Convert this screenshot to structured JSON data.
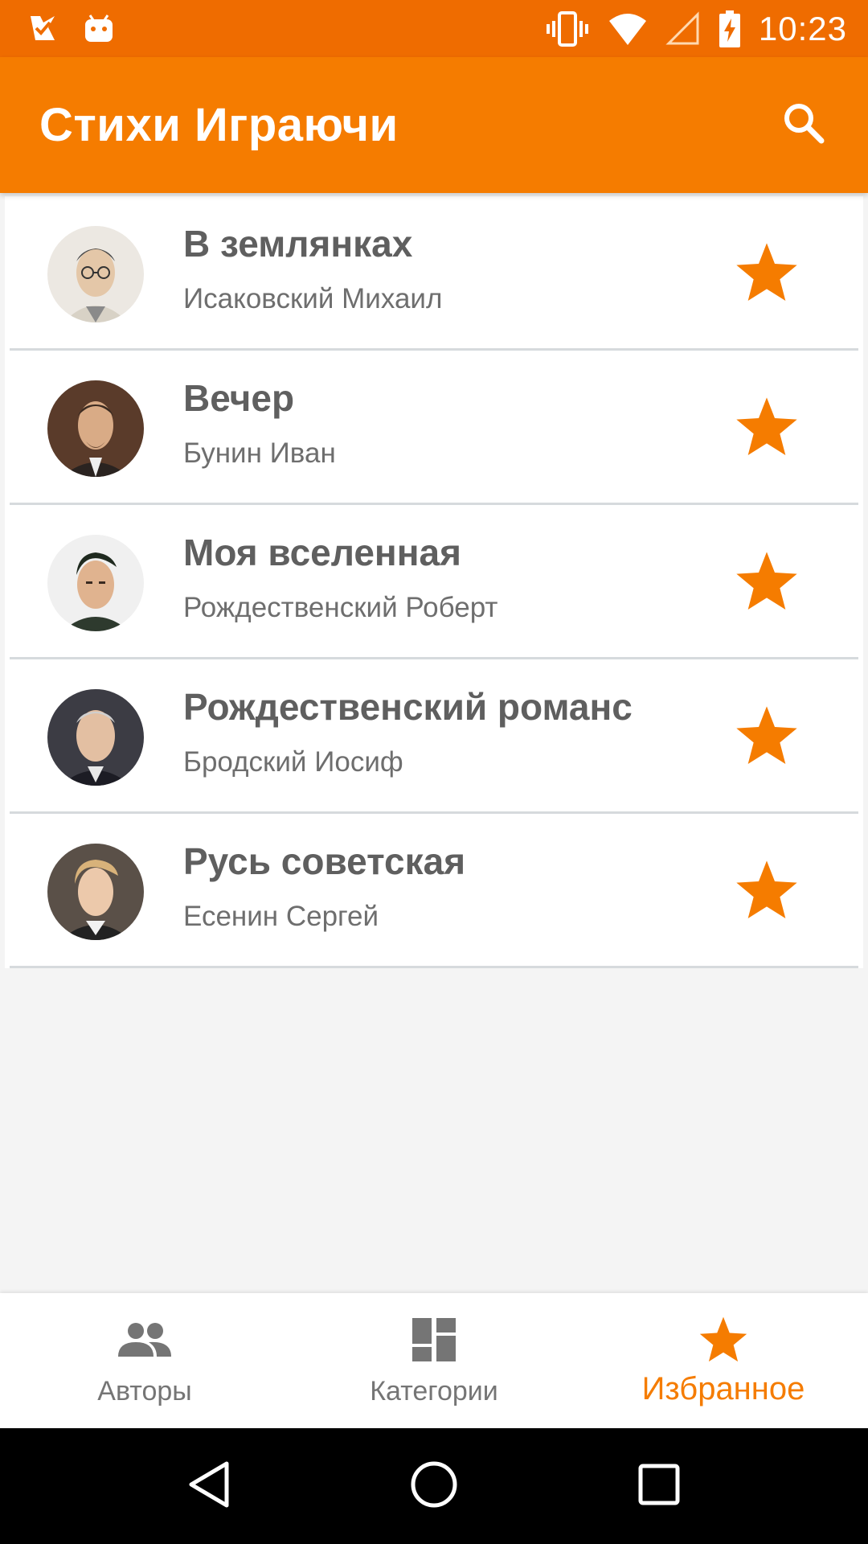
{
  "status_bar": {
    "time": "10:23",
    "icons": [
      "task-check-icon",
      "android-icon",
      "vibrate-icon",
      "wifi-icon",
      "signal-icon",
      "battery-charging-icon"
    ]
  },
  "app_bar": {
    "title": "Стихи Играючи",
    "search_icon": "search-icon"
  },
  "favorites": [
    {
      "title": "В землянках",
      "author": "Исаковский Михаил",
      "favorited": true
    },
    {
      "title": "Вечер",
      "author": "Бунин Иван",
      "favorited": true
    },
    {
      "title": "Моя вселенная",
      "author": "Рождественский Роберт",
      "favorited": true
    },
    {
      "title": "Рождественский романс",
      "author": "Бродский Иосиф",
      "favorited": true
    },
    {
      "title": "Русь советская",
      "author": "Есенин Сергей",
      "favorited": true
    }
  ],
  "bottom_nav": {
    "tabs": [
      {
        "label": "Авторы",
        "icon": "people-icon",
        "active": false
      },
      {
        "label": "Категории",
        "icon": "dashboard-icon",
        "active": false
      },
      {
        "label": "Избранное",
        "icon": "star-icon",
        "active": true
      }
    ]
  },
  "colors": {
    "status_bar": "#ef6c00",
    "app_bar": "#f57c00",
    "accent": "#f57c00",
    "title_text": "#5f5f5f",
    "secondary_text": "#6e6e6e",
    "divider": "#d6dadd"
  }
}
